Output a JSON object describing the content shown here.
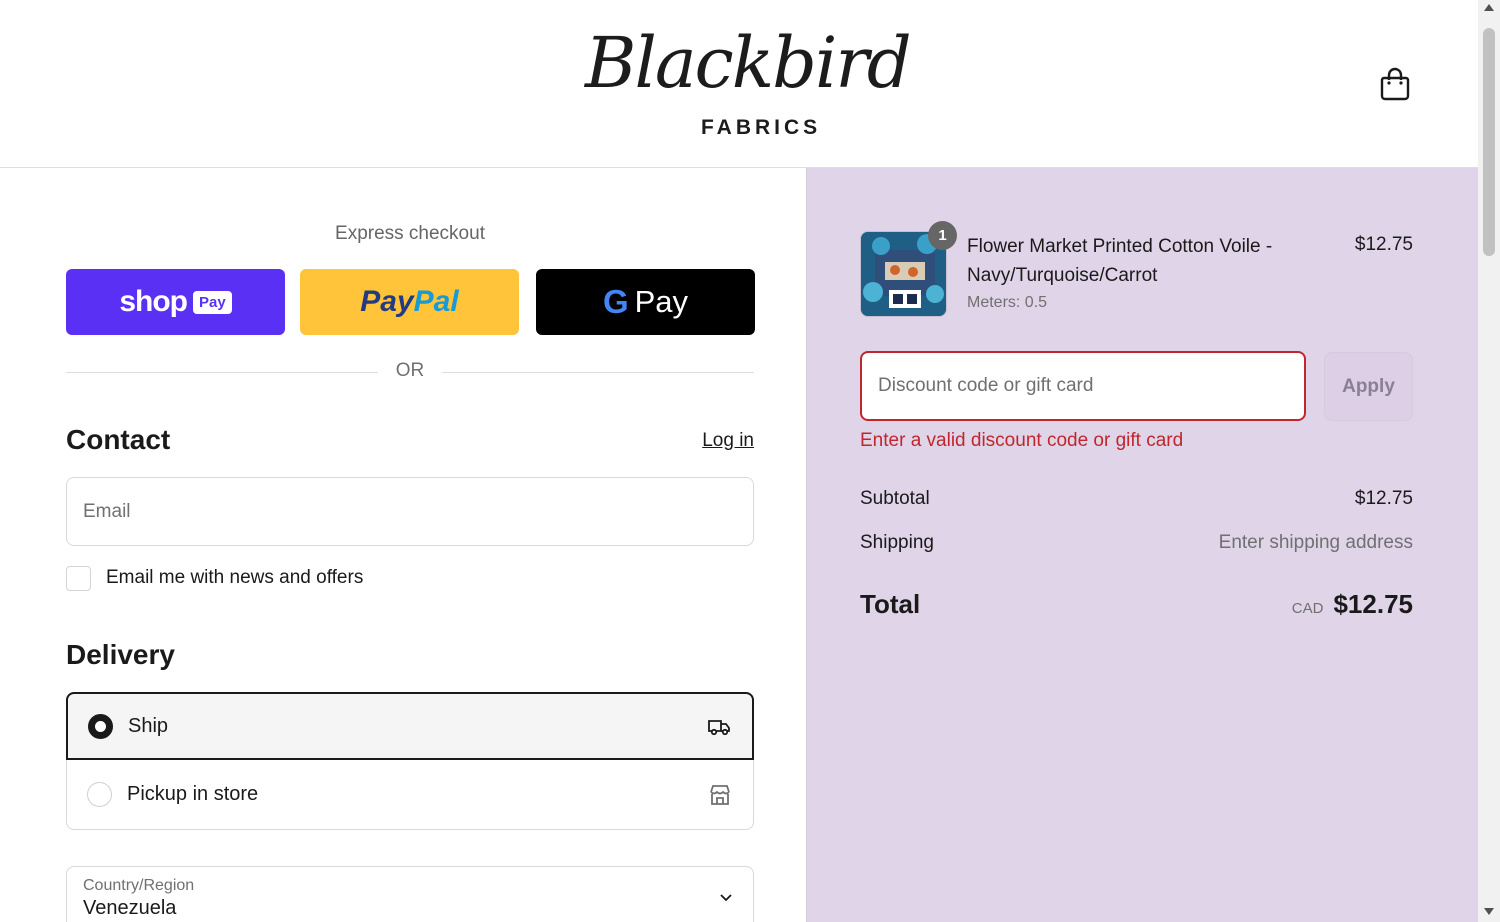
{
  "header": {
    "logo_script": "Blackbird",
    "logo_sub": "FABRICS",
    "cart_icon": "shopping-bag-icon"
  },
  "express": {
    "title": "Express checkout",
    "shop_pay_word": "shop",
    "shop_pay_badge": "Pay",
    "paypal_part1": "Pay",
    "paypal_part2": "Pal",
    "gpay_g": "G",
    "gpay_word": "Pay",
    "or_text": "OR"
  },
  "contact": {
    "heading": "Contact",
    "login_label": "Log in",
    "email_placeholder": "Email",
    "newsletter_label": "Email me with news and offers",
    "newsletter_checked": false
  },
  "delivery": {
    "heading": "Delivery",
    "options": [
      {
        "label": "Ship",
        "selected": true,
        "icon": "truck-icon"
      },
      {
        "label": "Pickup in store",
        "selected": false,
        "icon": "store-icon"
      }
    ],
    "country_label": "Country/Region",
    "country_value": "Venezuela"
  },
  "summary": {
    "product": {
      "name": "Flower Market Printed Cotton Voile - Navy/Turquoise/Carrot",
      "variant": "Meters: 0.5",
      "price": "$12.75",
      "quantity": "1"
    },
    "discount": {
      "placeholder": "Discount code or gift card",
      "apply_label": "Apply",
      "error": "Enter a valid discount code or gift card"
    },
    "subtotal_label": "Subtotal",
    "subtotal_value": "$12.75",
    "shipping_label": "Shipping",
    "shipping_value": "Enter shipping address",
    "total_label": "Total",
    "currency": "CAD",
    "total_value": "$12.75"
  },
  "colors": {
    "summary_bg": "#e0d5e8",
    "error": "#c0262d",
    "shop_pay": "#5a31f4",
    "paypal": "#ffc439"
  }
}
